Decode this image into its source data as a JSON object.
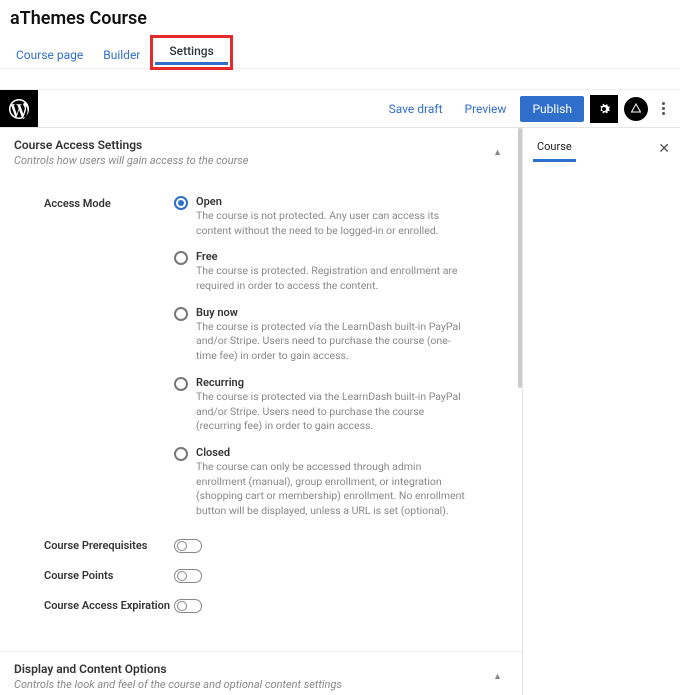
{
  "page": {
    "title": "aThemes Course"
  },
  "tabs": {
    "course_page": "Course page",
    "builder": "Builder",
    "settings": "Settings"
  },
  "editor": {
    "save_draft": "Save draft",
    "preview": "Preview",
    "publish": "Publish"
  },
  "sidebar": {
    "tab": "Course"
  },
  "panels": {
    "access": {
      "title": "Course Access Settings",
      "subtitle": "Controls how users will gain access to the course",
      "field_label": "Access Mode",
      "options": [
        {
          "title": "Open",
          "desc": "The course is not protected. Any user can access its content without the need to be logged-in or enrolled.",
          "checked": true
        },
        {
          "title": "Free",
          "desc": "The course is protected. Registration and enrollment are required in order to access the content.",
          "checked": false
        },
        {
          "title": "Buy now",
          "desc": "The course is protected via the LearnDash built-in PayPal and/or Stripe. Users need to purchase the course (one-time fee) in order to gain access.",
          "checked": false
        },
        {
          "title": "Recurring",
          "desc": "The course is protected via the LearnDash built-in PayPal and/or Stripe. Users need to purchase the course (recurring fee) in order to gain access.",
          "checked": false
        },
        {
          "title": "Closed",
          "desc": "The course can only be accessed through admin enrollment (manual), group enrollment, or integration (shopping cart or membership) enrollment. No enrollment button will be displayed, unless a URL is set (optional).",
          "checked": false
        }
      ],
      "prereq": "Course Prerequisites",
      "points": "Course Points",
      "expiration": "Course Access Expiration"
    },
    "display": {
      "title": "Display and Content Options",
      "subtitle": "Controls the look and feel of the course and optional content settings"
    }
  }
}
